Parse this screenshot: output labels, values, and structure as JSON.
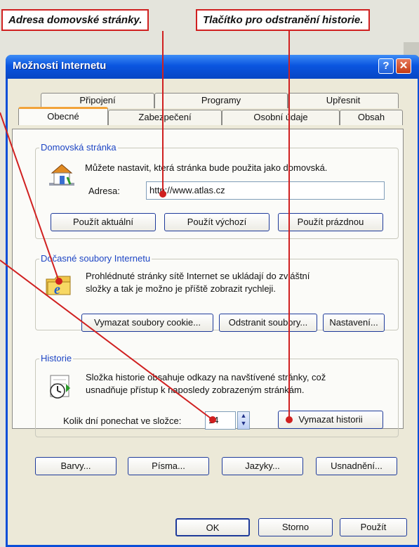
{
  "callouts": {
    "home_address": "Adresa domovské stránky.",
    "clear_history": "Tlačítko pro odstranění historie."
  },
  "window": {
    "title": "Možnosti Internetu",
    "help_icon": "?",
    "close_icon": "✕"
  },
  "tabs": {
    "row1": [
      "Připojení",
      "Programy",
      "Upřesnit"
    ],
    "row2": [
      "Obecné",
      "Zabezpečení",
      "Osobní údaje",
      "Obsah"
    ],
    "active": "Obecné"
  },
  "home": {
    "group_title": "Domovská stránka",
    "description": "Můžete nastavit, která stránka bude použita jako domovská.",
    "address_label": "Adresa:",
    "address_value": "http://www.atlas.cz",
    "btn_current": "Použít aktuální",
    "btn_default": "Použít výchozí",
    "btn_blank": "Použít prázdnou",
    "icon": "house-icon"
  },
  "temp": {
    "group_title": "Dočasné soubory Internetu",
    "description_line1": "Prohlédnuté stránky sítě Internet se ukládají do zvláštní",
    "description_line2": "složky a tak je možno je příště zobrazit rychleji.",
    "btn_cookies": "Vymazat soubory cookie...",
    "btn_delete": "Odstranit soubory...",
    "btn_settings": "Nastavení...",
    "icon": "folder-ie-icon"
  },
  "history": {
    "group_title": "Historie",
    "description_line1": "Složka historie obsahuje odkazy na navštívené stránky, což",
    "description_line2": "usnadňuje přístup k naposledy zobrazeným stránkám.",
    "days_label": "Kolik dní ponechat ve složce:",
    "days_value": "14",
    "btn_clear": "Vymazat historii",
    "icon": "history-clock-icon"
  },
  "bottom_buttons": {
    "colors": "Barvy...",
    "fonts": "Písma...",
    "languages": "Jazyky...",
    "accessibility": "Usnadnění..."
  },
  "dialog_buttons": {
    "ok": "OK",
    "cancel": "Storno",
    "apply": "Použít"
  },
  "colors": {
    "callout_border": "#d02020",
    "titlebar": "#0a55e0",
    "group_title": "#1d45c4",
    "active_tab_accent": "#f2a33a"
  }
}
